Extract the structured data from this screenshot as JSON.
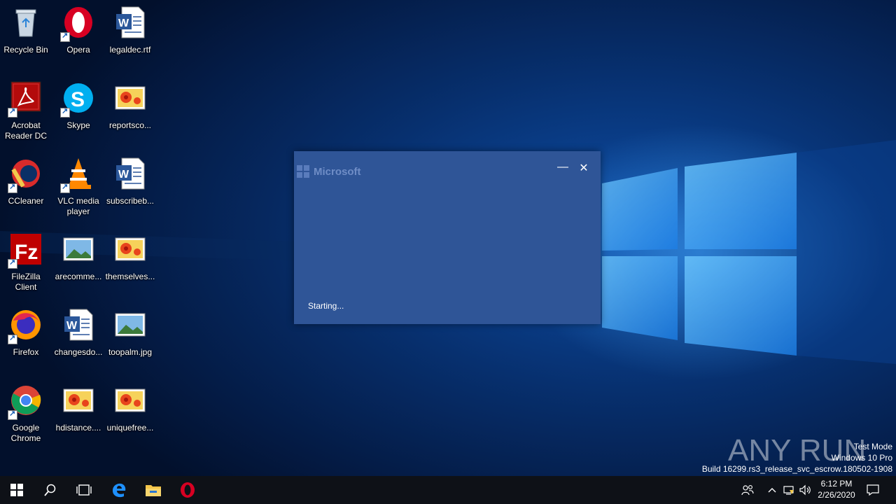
{
  "desktop": {
    "icons": [
      {
        "label": "Recycle Bin",
        "icon": "recycle-bin-icon"
      },
      {
        "label": "Opera",
        "icon": "opera-icon"
      },
      {
        "label": "legaldec.rtf",
        "icon": "word-document-icon"
      },
      {
        "label": "Acrobat Reader DC",
        "icon": "acrobat-icon"
      },
      {
        "label": "Skype",
        "icon": "skype-icon"
      },
      {
        "label": "reportsco...",
        "icon": "image-file-icon"
      },
      {
        "label": "CCleaner",
        "icon": "ccleaner-icon"
      },
      {
        "label": "VLC media player",
        "icon": "vlc-icon"
      },
      {
        "label": "subscribeb...",
        "icon": "word-document-icon"
      },
      {
        "label": "FileZilla Client",
        "icon": "filezilla-icon"
      },
      {
        "label": "arecomme...",
        "icon": "landscape-image-icon"
      },
      {
        "label": "themselves...",
        "icon": "image-file-icon"
      },
      {
        "label": "Firefox",
        "icon": "firefox-icon"
      },
      {
        "label": "changesdo...",
        "icon": "word-document-icon"
      },
      {
        "label": "toopalm.jpg",
        "icon": "landscape-image-icon"
      },
      {
        "label": "Google Chrome",
        "icon": "chrome-icon"
      },
      {
        "label": "hdistance....",
        "icon": "image-file-icon"
      },
      {
        "label": "uniquefree...",
        "icon": "image-file-icon"
      }
    ]
  },
  "dialog": {
    "brand": "Microsoft",
    "status": "Starting...",
    "minimize": "—",
    "close": "✕"
  },
  "watermark": {
    "brand": "ANY RUN",
    "line1": "Test Mode",
    "line2": "Windows 10 Pro",
    "line3": "Build 16299.rs3_release_svc_escrow.180502-1908"
  },
  "taskbar": {
    "time": "6:12 PM",
    "date": "2/26/2020",
    "icons": [
      "start-icon",
      "search-icon",
      "task-view-icon",
      "edge-icon",
      "file-explorer-icon",
      "opera-icon"
    ],
    "tray": [
      "people-icon",
      "chevron-up-icon",
      "network-icon",
      "volume-icon",
      "notification-icon"
    ]
  },
  "colors": {
    "dialog_bg": "#2f5597",
    "taskbar_bg": "#0e1117",
    "desktop_accent": "#0d4ea8"
  }
}
